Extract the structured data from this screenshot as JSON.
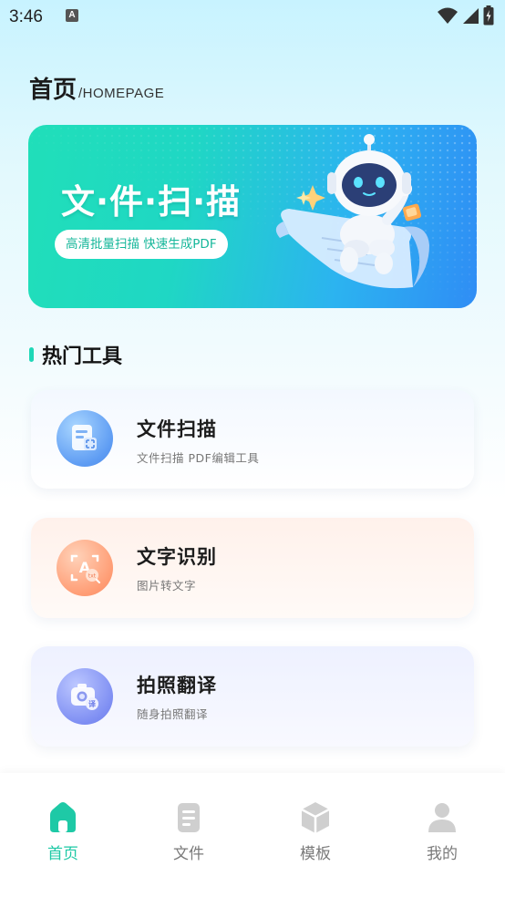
{
  "status_bar": {
    "time": "3:46",
    "notification_badge": "A"
  },
  "header": {
    "title": "首页",
    "subtitle": "/HOMEPAGE"
  },
  "banner": {
    "title": "文·件·扫·描",
    "tagline": "高清批量扫描 快速生成PDF"
  },
  "section": {
    "title": "热门工具"
  },
  "tools": [
    {
      "name": "文件扫描",
      "desc": "文件扫描 PDF编辑工具",
      "icon": "document-scan-icon"
    },
    {
      "name": "文字识别",
      "desc": "图片转文字",
      "icon": "text-recognition-icon"
    },
    {
      "name": "拍照翻译",
      "desc": "随身拍照翻译",
      "icon": "camera-translate-icon"
    }
  ],
  "nav": {
    "home": "首页",
    "files": "文件",
    "templates": "模板",
    "mine": "我的"
  },
  "colors": {
    "accent": "#1ec9a6",
    "inactive": "#7a7a7a",
    "banner_start": "#20dfb9",
    "banner_end": "#2f8df5"
  }
}
